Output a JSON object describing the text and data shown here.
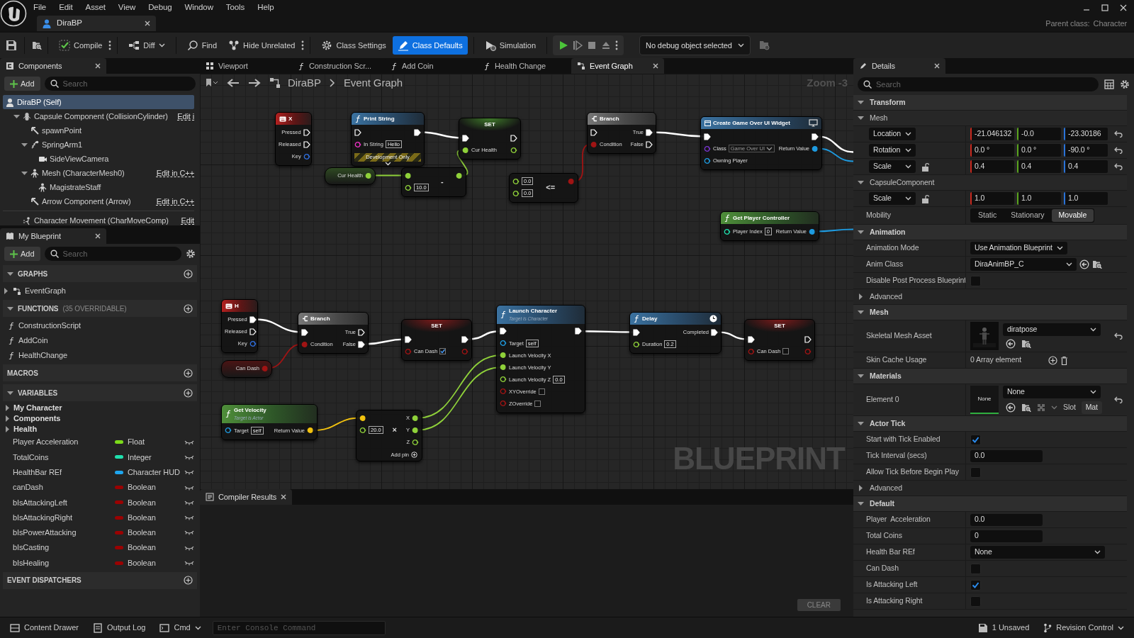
{
  "menu": [
    "File",
    "Edit",
    "Asset",
    "View",
    "Debug",
    "Window",
    "Tools",
    "Help"
  ],
  "document_tab": {
    "label": "DiraBP"
  },
  "parent_class": {
    "label": "Parent class:",
    "value": "Character"
  },
  "toolbar": [
    {
      "label": "Compile",
      "selected": false
    },
    {
      "label": "Diff",
      "selected": false
    },
    {
      "label": "Find",
      "selected": false
    },
    {
      "label": "Hide Unrelated",
      "selected": false
    },
    {
      "label": "Class Settings",
      "selected": false
    },
    {
      "label": "Class Defaults",
      "selected": true
    },
    {
      "label": "Simulation",
      "selected": false
    }
  ],
  "debug_filter": {
    "value": "No debug object selected"
  },
  "components": {
    "tab": "Components",
    "add": "Add",
    "search_placeholder": "Search",
    "tree": [
      {
        "label": "DiraBP (Self)",
        "kind": "self",
        "selected": true,
        "children": [
          {
            "label": "Capsule Component (CollisionCylinder)",
            "kind": "capsule",
            "link": "Edit i",
            "selected": false,
            "expanded": true,
            "children": [
              {
                "label": "spawnPoint",
                "kind": "arrow",
                "selected": false
              },
              {
                "label": "SpringArm1",
                "kind": "spring",
                "selected": false,
                "expanded": true,
                "children": [
                  {
                    "label": "SideViewCamera",
                    "kind": "camera",
                    "selected": false
                  }
                ]
              },
              {
                "label": "Mesh (CharacterMesh0)",
                "kind": "mesh",
                "link": "Edit in C++",
                "selected": false,
                "expanded": true,
                "children": [
                  {
                    "label": "MagistrateStaff",
                    "kind": "mesh",
                    "selected": false
                  }
                ]
              },
              {
                "label": "Arrow Component (Arrow)",
                "kind": "arrow",
                "link": "Edit in C++",
                "selected": false
              }
            ]
          }
        ]
      }
    ],
    "other": [
      {
        "label": "Character Movement (CharMoveComp)",
        "kind": "movement",
        "link": "Edit",
        "selected": false
      }
    ]
  },
  "my_blueprint": {
    "tab": "My Blueprint",
    "add": "Add",
    "search_placeholder": "Search",
    "sections": [
      {
        "kind": "list",
        "title": "GRAPHS",
        "expanded": true,
        "items": [
          {
            "label": "EventGraph",
            "expanded": false
          }
        ]
      },
      {
        "kind": "list",
        "title": "FUNCTIONS",
        "note": "(35 OVERRIDABLE)",
        "expanded": true,
        "items": [
          {
            "label": "ConstructionScript"
          },
          {
            "label": "AddCoin"
          },
          {
            "label": "HealthChange"
          }
        ]
      },
      {
        "kind": "list",
        "title": "MACROS"
      },
      {
        "kind": "variables",
        "title": "VARIABLES",
        "expanded": true,
        "categories": [
          {
            "label": "My Character",
            "expanded": false
          },
          {
            "label": "Components",
            "expanded": false
          },
          {
            "label": "Health",
            "expanded": false
          }
        ],
        "variables": [
          {
            "name": "Player Acceleration",
            "type": "Float",
            "color": "#7cdb1a"
          },
          {
            "name": "TotalCoins",
            "type": "Integer",
            "color": "#1fe0ad"
          },
          {
            "name": "HealthBar REf",
            "type": "Character HUD",
            "color": "#1ea6ef"
          },
          {
            "name": "canDash",
            "type": "Boolean",
            "color": "#9a0202"
          },
          {
            "name": "bIsAttackingLeft",
            "type": "Boolean",
            "color": "#9a0202"
          },
          {
            "name": "bIsAttackingRight",
            "type": "Boolean",
            "color": "#9a0202"
          },
          {
            "name": "bIsPowerAttacking",
            "type": "Boolean",
            "color": "#9a0202"
          },
          {
            "name": "bIsCasting",
            "type": "Boolean",
            "color": "#9a0202"
          },
          {
            "name": "bIsHealing",
            "type": "Boolean",
            "color": "#9a0202"
          }
        ]
      },
      {
        "kind": "list",
        "title": "EVENT DISPATCHERS"
      }
    ]
  },
  "graph_tabs": [
    {
      "label": "Viewport",
      "selected": false
    },
    {
      "label": "Construction Scr...",
      "selected": false
    },
    {
      "label": "Add Coin",
      "selected": false
    },
    {
      "label": "Health Change",
      "selected": false
    },
    {
      "label": "Event Graph",
      "selected": true
    }
  ],
  "graph": {
    "breadcrumb": [
      "DiraBP",
      "Event Graph"
    ],
    "zoom": "Zoom -3",
    "watermark": "BLUEPRINT",
    "nodes": [
      {
        "kind": "event",
        "title": "X",
        "rows": [
          {
            "out": {
              "kind": "exec",
              "label": "Pressed",
              "linked": false
            }
          },
          {
            "out": {
              "kind": "exec",
              "label": "Released",
              "linked": false
            }
          },
          {
            "out": {
              "kind": "key",
              "label": "Key",
              "linked": false
            }
          }
        ]
      },
      {
        "kind": "function",
        "title": "Print String",
        "banner": "Development Only",
        "rows": [
          {
            "in": {
              "kind": "exec",
              "linked": false
            },
            "out": {
              "kind": "exec",
              "linked": true
            }
          },
          {
            "in": {
              "kind": "string",
              "label": "In String",
              "value": "Hello",
              "linked": false
            }
          }
        ]
      },
      {
        "kind": "set",
        "title": "SET",
        "rows": [
          {
            "in": {
              "kind": "exec",
              "linked": true
            },
            "out": {
              "kind": "exec",
              "linked": false
            }
          },
          {
            "in": {
              "kind": "float",
              "label": "Cur Health",
              "linked": true
            },
            "out": {
              "kind": "float",
              "linked": false
            }
          }
        ]
      },
      {
        "kind": "getter",
        "rows": [
          {
            "out": {
              "kind": "float",
              "label": "Cur Health",
              "linked": true
            }
          }
        ]
      },
      {
        "kind": "operator",
        "symbol": "-",
        "rows": [
          {
            "in": {
              "kind": "float",
              "linked": true
            },
            "out": {
              "kind": "float",
              "linked": true
            }
          },
          {
            "in": {
              "kind": "float",
              "value": "10.0",
              "linked": false
            }
          }
        ]
      },
      {
        "kind": "operator",
        "symbol": "<=",
        "rows": [
          {
            "in": {
              "kind": "float",
              "value": "0.0",
              "linked": false
            },
            "out": {
              "kind": "bool",
              "linked": true
            }
          },
          {
            "in": {
              "kind": "float",
              "value": "0.0",
              "linked": false
            }
          }
        ]
      },
      {
        "kind": "branch",
        "title": "Branch",
        "rows": [
          {
            "in": {
              "kind": "exec",
              "linked": false
            },
            "out": {
              "kind": "exec",
              "label": "True",
              "linked": true
            }
          },
          {
            "in": {
              "kind": "bool",
              "label": "Condition",
              "linked": true
            },
            "out": {
              "kind": "exec",
              "label": "False",
              "linked": false
            }
          }
        ]
      },
      {
        "kind": "widget",
        "title": "Create Game Over UI Widget",
        "rows": [
          {
            "in": {
              "kind": "exec",
              "linked": true
            },
            "out": {
              "kind": "exec",
              "linked": true
            }
          },
          {
            "in": {
              "kind": "class",
              "label": "Class",
              "value": "Game Over UI",
              "linked": false
            },
            "out": {
              "kind": "object",
              "label": "Return Value",
              "linked": true
            }
          },
          {
            "in": {
              "kind": "object",
              "label": "Owning Player",
              "linked": false
            }
          }
        ]
      },
      {
        "kind": "pure",
        "title": "Get Player Controller",
        "rows": [
          {
            "in": {
              "kind": "int",
              "label": "Player Index",
              "value": "0",
              "linked": false
            },
            "out": {
              "kind": "object",
              "label": "Return Value",
              "linked": true
            }
          }
        ]
      },
      {
        "kind": "event",
        "title": "H",
        "rows": [
          {
            "out": {
              "kind": "exec",
              "label": "Pressed",
              "linked": true
            }
          },
          {
            "out": {
              "kind": "exec",
              "label": "Released",
              "linked": false
            }
          },
          {
            "out": {
              "kind": "key",
              "label": "Key",
              "linked": false
            }
          }
        ]
      },
      {
        "kind": "branch",
        "title": "Branch",
        "rows": [
          {
            "in": {
              "kind": "exec",
              "linked": true
            },
            "out": {
              "kind": "exec",
              "label": "True",
              "linked": false
            }
          },
          {
            "in": {
              "kind": "bool",
              "label": "Condition",
              "linked": true
            },
            "out": {
              "kind": "exec",
              "label": "False",
              "linked": true
            }
          }
        ]
      },
      {
        "kind": "getter",
        "rows": [
          {
            "out": {
              "kind": "bool",
              "label": "Can Dash",
              "linked": true
            }
          }
        ]
      },
      {
        "kind": "set",
        "title": "SET",
        "rows": [
          {
            "in": {
              "kind": "exec",
              "linked": true
            },
            "out": {
              "kind": "exec",
              "linked": true
            }
          },
          {
            "in": {
              "kind": "bool",
              "label": "Can Dash",
              "checked": true,
              "linked": false
            },
            "out": {
              "kind": "bool",
              "linked": false
            }
          }
        ]
      },
      {
        "kind": "function",
        "title": "Launch Character",
        "subtitle": "Target is Character",
        "rows": [
          {
            "in": {
              "kind": "exec",
              "linked": true
            },
            "out": {
              "kind": "exec",
              "linked": true
            }
          },
          {
            "in": {
              "kind": "object",
              "label": "Target",
              "value": "self",
              "linked": false
            }
          },
          {
            "in": {
              "kind": "float",
              "label": "Launch Velocity X",
              "linked": true
            }
          },
          {
            "in": {
              "kind": "float",
              "label": "Launch Velocity Y",
              "linked": true
            }
          },
          {
            "in": {
              "kind": "float",
              "label": "Launch Velocity Z",
              "value": "0.0",
              "linked": false
            }
          },
          {
            "in": {
              "kind": "bool",
              "label": "XYOverride",
              "checked": false,
              "linked": false
            }
          },
          {
            "in": {
              "kind": "bool",
              "label": "ZOverride",
              "checked": false,
              "linked": false
            }
          }
        ]
      },
      {
        "kind": "function",
        "title": "Delay",
        "latent": true,
        "rows": [
          {
            "in": {
              "kind": "exec",
              "linked": true
            },
            "out": {
              "kind": "exec",
              "label": "Completed",
              "linked": true
            }
          },
          {
            "in": {
              "kind": "float",
              "label": "Duration",
              "value": "0.2",
              "linked": false
            }
          }
        ]
      },
      {
        "kind": "set",
        "title": "SET",
        "rows": [
          {
            "in": {
              "kind": "exec",
              "linked": true
            },
            "out": {
              "kind": "exec",
              "linked": false
            }
          },
          {
            "in": {
              "kind": "bool",
              "label": "Can Dash",
              "checked": false,
              "linked": false
            },
            "out": {
              "kind": "bool",
              "linked": false
            }
          }
        ]
      },
      {
        "kind": "pure",
        "title": "Get Velocity",
        "subtitle": "Target is Actor",
        "rows": [
          {
            "in": {
              "kind": "object",
              "label": "Target",
              "value": "self",
              "linked": false
            },
            "out": {
              "kind": "vector",
              "label": "Return Value",
              "linked": true
            }
          }
        ]
      },
      {
        "kind": "operator",
        "symbol": "×",
        "footer": "Add pin",
        "rows": [
          {
            "in": {
              "kind": "vector",
              "linked": true
            },
            "out": {
              "kind": "float",
              "label": "X",
              "linked": true
            }
          },
          {
            "in": {
              "kind": "float",
              "value": "20.0",
              "linked": false
            },
            "out": {
              "kind": "float",
              "label": "Y",
              "linked": true
            }
          },
          {
            "out": {
              "kind": "float",
              "label": "Z",
              "linked": false
            }
          }
        ]
      }
    ]
  },
  "compiler_results": {
    "tab": "Compiler Results",
    "clear": "CLEAR"
  },
  "details": {
    "tab": "Details",
    "search_placeholder": "Search",
    "rows": [
      {
        "kind": "section",
        "label": "Transform",
        "expanded": true
      },
      {
        "kind": "subsection",
        "label": "Mesh",
        "expanded": true
      },
      {
        "kind": "vector",
        "label": "Location",
        "values": [
          "-21.046132",
          "-0.0",
          "-23.30186"
        ],
        "resettable": true
      },
      {
        "kind": "vector",
        "label": "Rotation",
        "values": [
          "0.0 °",
          "0.0 °",
          "-90.0 °"
        ],
        "resettable": true
      },
      {
        "kind": "vector",
        "label": "Scale",
        "values": [
          "0.4",
          "0.4",
          "0.4"
        ],
        "locked": false,
        "resettable": true
      },
      {
        "kind": "subsection",
        "label": "CapsuleComponent",
        "expanded": true
      },
      {
        "kind": "vector",
        "label": "Scale",
        "values": [
          "1.0",
          "1.0",
          "1.0"
        ],
        "locked": false
      },
      {
        "kind": "segmented",
        "label": "Mobility",
        "options": [
          {
            "label": "Static",
            "selected": false
          },
          {
            "label": "Stationary",
            "selected": false
          },
          {
            "label": "Movable",
            "selected": true
          }
        ]
      },
      {
        "kind": "section",
        "label": "Animation",
        "expanded": true
      },
      {
        "kind": "dropdown",
        "label": "Animation Mode",
        "value": "Use Animation Blueprint"
      },
      {
        "kind": "class_picker",
        "label": "Anim Class",
        "value": "DiraAnimBP_C"
      },
      {
        "kind": "checkbox",
        "label": "Disable Post Process Blueprint",
        "checked": false
      },
      {
        "kind": "category",
        "label": "Advanced",
        "expanded": false
      },
      {
        "kind": "section",
        "label": "Mesh",
        "expanded": true
      },
      {
        "kind": "asset",
        "label": "Skeletal Mesh Asset",
        "value": "diratpose",
        "resettable": true
      },
      {
        "kind": "array",
        "label": "Skin Cache Usage",
        "value": "0 Array element"
      },
      {
        "kind": "section",
        "label": "Materials",
        "expanded": true
      },
      {
        "kind": "material",
        "label": "Element 0",
        "thumb": "None",
        "value": "None",
        "slot_label": "Slot",
        "slot": "Mat",
        "resettable": true
      },
      {
        "kind": "section",
        "label": "Actor Tick",
        "expanded": true
      },
      {
        "kind": "checkbox",
        "label": "Start with Tick Enabled",
        "checked": true
      },
      {
        "kind": "number",
        "label": "Tick Interval (secs)",
        "value": "0.0"
      },
      {
        "kind": "checkbox",
        "label": "Allow Tick Before Begin Play",
        "checked": false
      },
      {
        "kind": "category",
        "label": "Advanced",
        "expanded": false
      },
      {
        "kind": "section",
        "label": "Default",
        "expanded": true
      },
      {
        "kind": "number",
        "label": "Player  Acceleration",
        "value": "0.0"
      },
      {
        "kind": "number",
        "label": "Total Coins",
        "value": "0"
      },
      {
        "kind": "dropdown_wide",
        "label": "Health Bar REf",
        "value": "None"
      },
      {
        "kind": "checkbox",
        "label": "Can Dash",
        "checked": false
      },
      {
        "kind": "checkbox",
        "label": "Is Attacking Left",
        "checked": true
      },
      {
        "kind": "checkbox",
        "label": "Is Attacking Right",
        "checked": false
      }
    ]
  },
  "status_bar": {
    "items": [
      {
        "label": "Content Drawer"
      },
      {
        "label": "Output Log"
      },
      {
        "label": "Cmd"
      }
    ],
    "console_placeholder": "Enter Console Command",
    "unsaved": "1 Unsaved",
    "revision": "Revision Control"
  }
}
